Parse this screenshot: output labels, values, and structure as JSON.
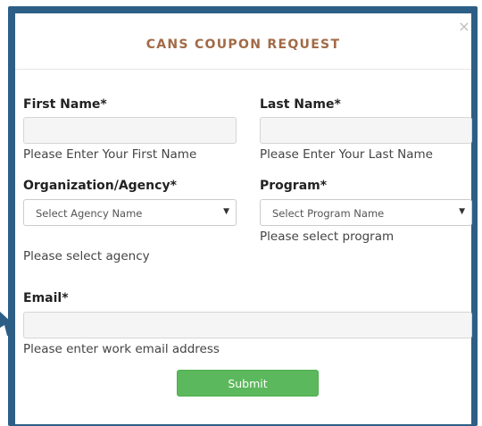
{
  "modal": {
    "title": "CANS COUPON REQUEST",
    "close_label": "×"
  },
  "form": {
    "first_name": {
      "label": "First Name*",
      "value": "",
      "hint": "Please Enter Your First Name"
    },
    "last_name": {
      "label": "Last Name*",
      "value": "",
      "hint": "Please Enter Your Last Name"
    },
    "agency": {
      "label": "Organization/Agency*",
      "selected": "Select Agency Name",
      "hint": "Please select agency"
    },
    "program": {
      "label": "Program*",
      "selected": "Select Program Name",
      "hint": "Please select program"
    },
    "email": {
      "label": "Email*",
      "value": "",
      "hint": "Please enter work email address"
    },
    "submit_label": "Submit"
  },
  "icons": {
    "close": "close-icon",
    "caret": "chevron-down-icon",
    "pointer": "arrow-pointer-icon"
  },
  "colors": {
    "frame": "#2d5f86",
    "title": "#a26a46",
    "submit": "#5cb85c"
  }
}
